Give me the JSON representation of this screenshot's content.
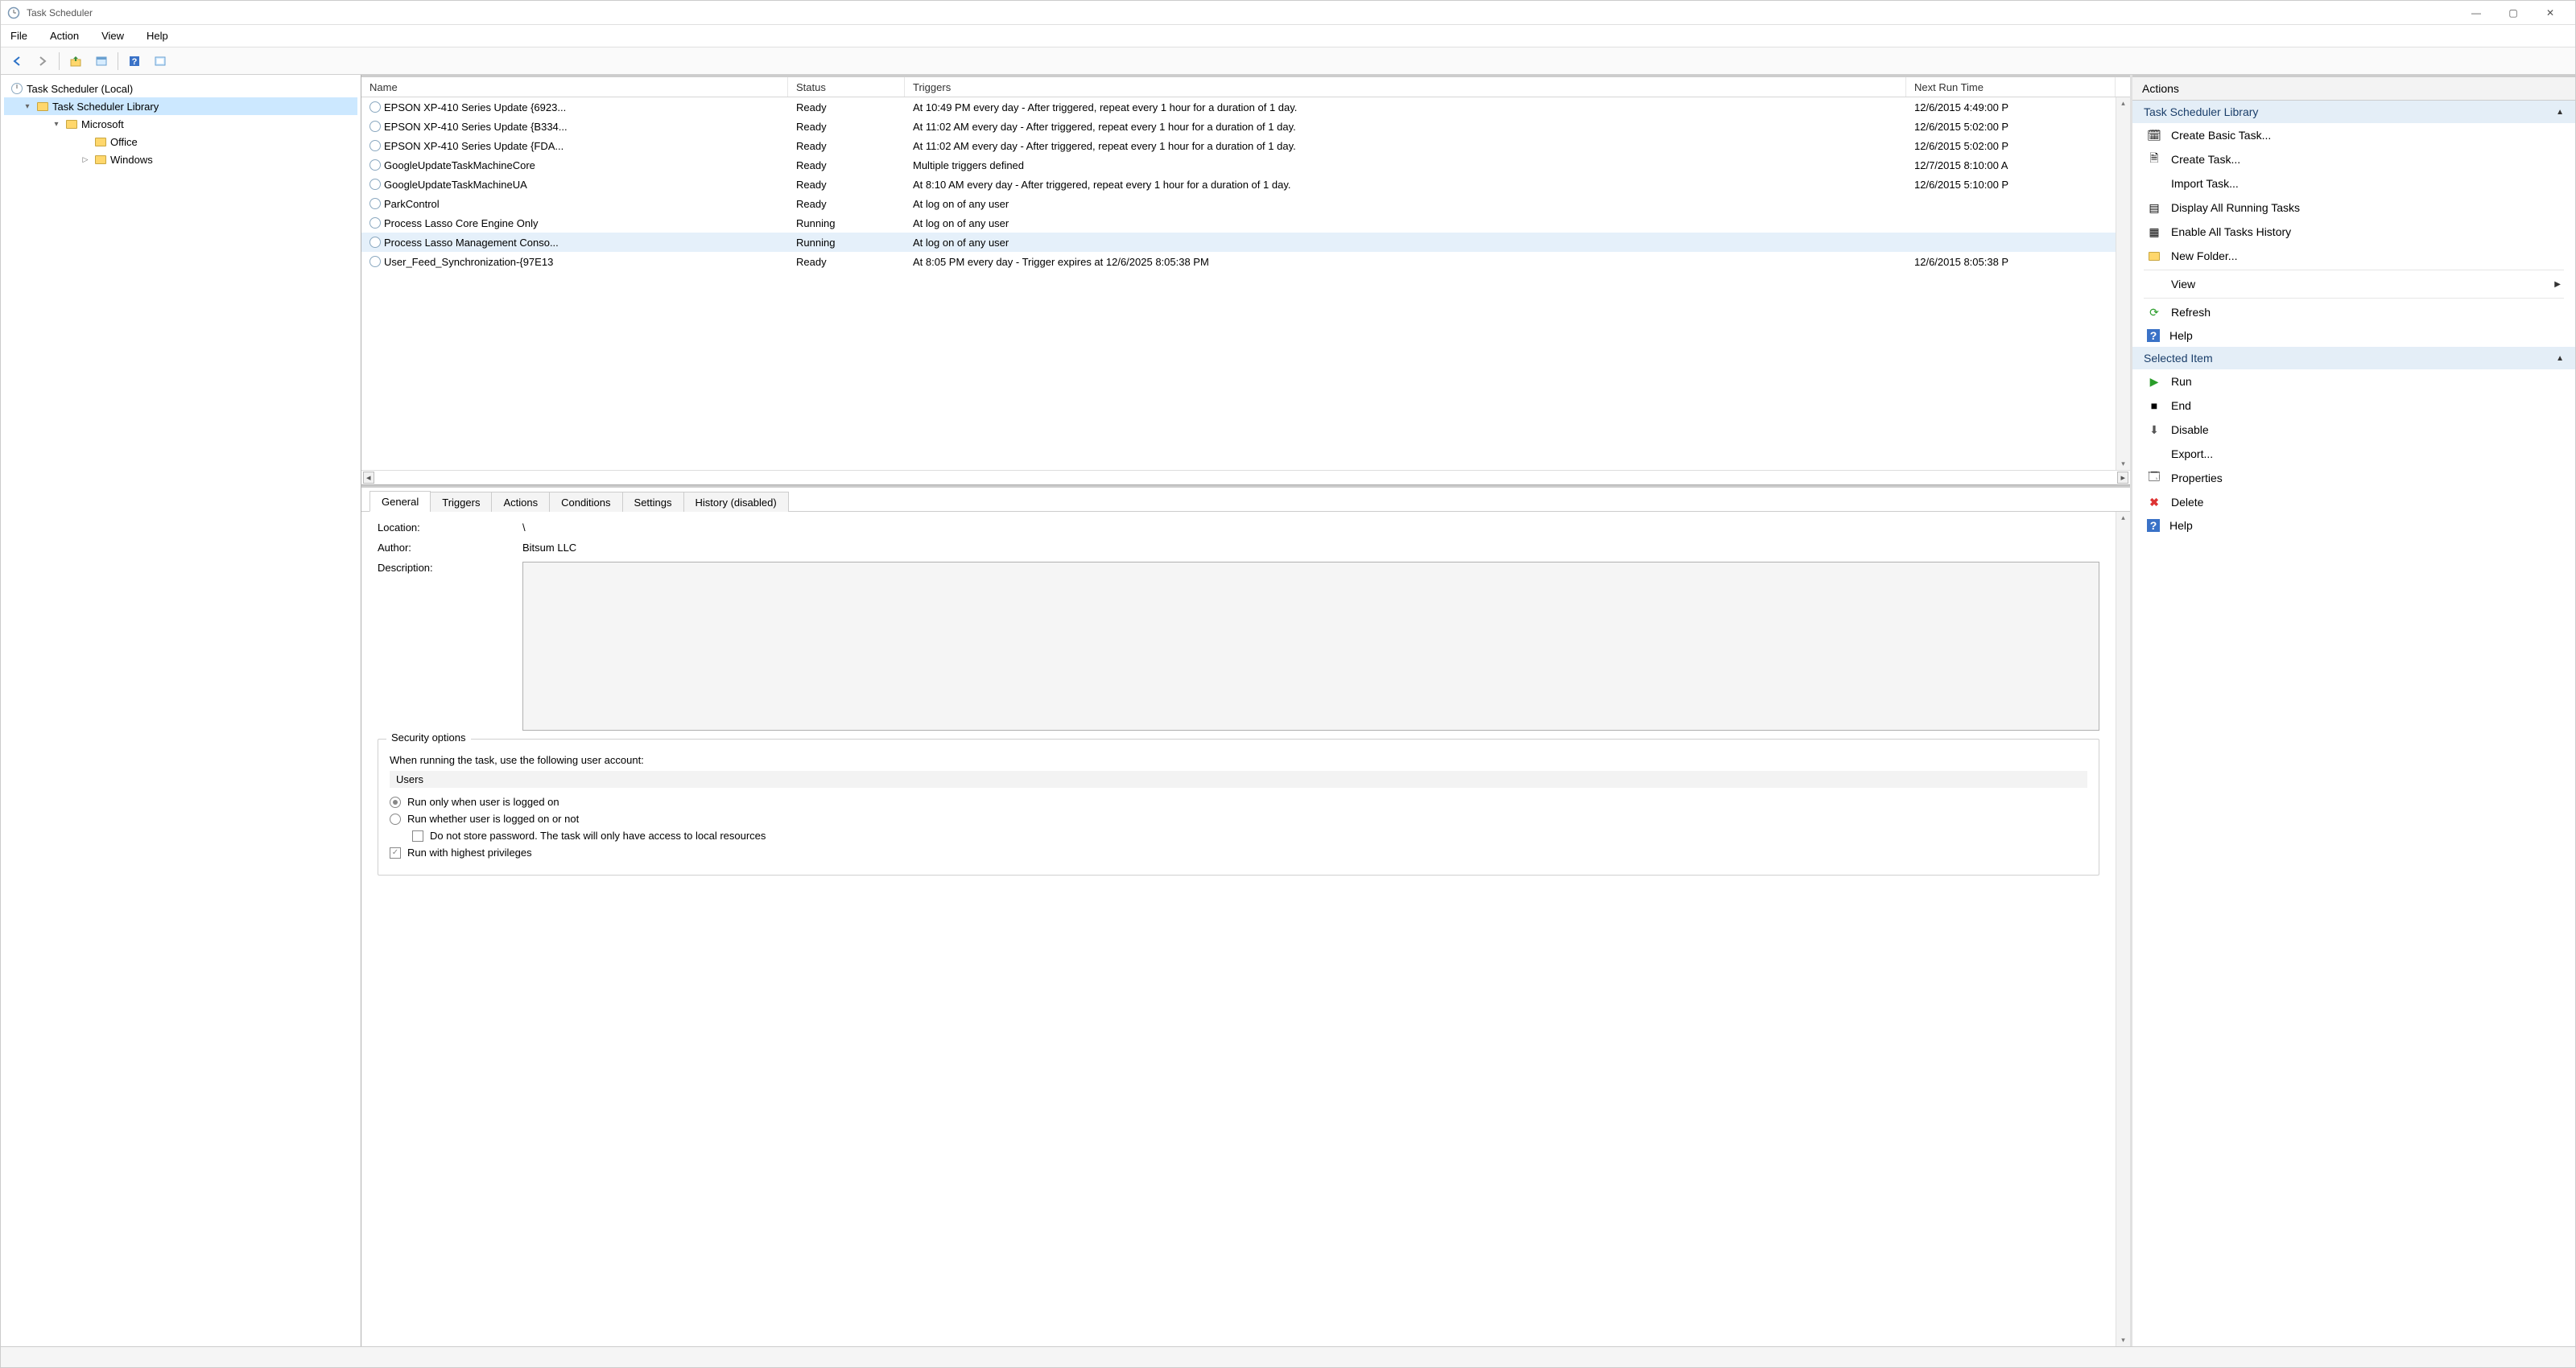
{
  "window": {
    "title": "Task Scheduler"
  },
  "menu": {
    "file": "File",
    "action": "Action",
    "view": "View",
    "help": "Help"
  },
  "tree": {
    "root": "Task Scheduler (Local)",
    "library": "Task Scheduler Library",
    "microsoft": "Microsoft",
    "office": "Office",
    "windows": "Windows"
  },
  "task_table": {
    "headers": {
      "name": "Name",
      "status": "Status",
      "triggers": "Triggers",
      "next_run": "Next Run Time"
    },
    "rows": [
      {
        "name": "EPSON XP-410 Series Update {6923...",
        "status": "Ready",
        "triggers": "At 10:49 PM every day - After triggered, repeat every 1 hour for a duration of 1 day.",
        "next_run": "12/6/2015 4:49:00 P"
      },
      {
        "name": "EPSON XP-410 Series Update {B334...",
        "status": "Ready",
        "triggers": "At 11:02 AM every day - After triggered, repeat every 1 hour for a duration of 1 day.",
        "next_run": "12/6/2015 5:02:00 P"
      },
      {
        "name": "EPSON XP-410 Series Update {FDA...",
        "status": "Ready",
        "triggers": "At 11:02 AM every day - After triggered, repeat every 1 hour for a duration of 1 day.",
        "next_run": "12/6/2015 5:02:00 P"
      },
      {
        "name": "GoogleUpdateTaskMachineCore",
        "status": "Ready",
        "triggers": "Multiple triggers defined",
        "next_run": "12/7/2015 8:10:00 A"
      },
      {
        "name": "GoogleUpdateTaskMachineUA",
        "status": "Ready",
        "triggers": "At 8:10 AM every day - After triggered, repeat every 1 hour for a duration of 1 day.",
        "next_run": "12/6/2015 5:10:00 P"
      },
      {
        "name": "ParkControl",
        "status": "Ready",
        "triggers": "At log on of any user",
        "next_run": ""
      },
      {
        "name": "Process Lasso Core Engine Only",
        "status": "Running",
        "triggers": "At log on of any user",
        "next_run": ""
      },
      {
        "name": "Process Lasso Management Conso...",
        "status": "Running",
        "triggers": "At log on of any user",
        "next_run": "",
        "selected": true
      },
      {
        "name": "User_Feed_Synchronization-{97E13",
        "status": "Ready",
        "triggers": "At 8:05 PM every day - Trigger expires at 12/6/2025 8:05:38 PM",
        "next_run": "12/6/2015 8:05:38 P"
      }
    ]
  },
  "tabs": {
    "general": "General",
    "triggers": "Triggers",
    "actions": "Actions",
    "conditions": "Conditions",
    "settings": "Settings",
    "history": "History (disabled)"
  },
  "details": {
    "location_label": "Location:",
    "location_value": "\\",
    "author_label": "Author:",
    "author_value": "Bitsum LLC",
    "description_label": "Description:",
    "security": {
      "legend": "Security options",
      "when_running": "When running the task, use the following user account:",
      "user": "Users",
      "run_logged_on": "Run only when user is logged on",
      "run_whether": "Run whether user is logged on or not",
      "no_password": "Do not store password.  The task will only have access to local resources",
      "highest": "Run with highest privileges"
    }
  },
  "actions": {
    "header": "Actions",
    "section1": "Task Scheduler Library",
    "create_basic": "Create Basic Task...",
    "create_task": "Create Task...",
    "import_task": "Import Task...",
    "display_running": "Display All Running Tasks",
    "enable_history": "Enable All Tasks History",
    "new_folder": "New Folder...",
    "view": "View",
    "refresh": "Refresh",
    "help": "Help",
    "section2": "Selected Item",
    "run": "Run",
    "end": "End",
    "disable": "Disable",
    "export": "Export...",
    "properties": "Properties",
    "delete": "Delete",
    "help2": "Help"
  }
}
